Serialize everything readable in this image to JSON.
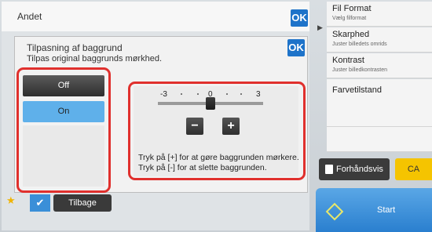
{
  "outer": {
    "title": "Andet",
    "ok_label": "OK"
  },
  "dialog": {
    "ok_label": "OK",
    "title": "Tilpasning af baggrund",
    "subtitle": "Tilpas original baggrunds mørkhed.",
    "off_label": "Off",
    "on_label": "On",
    "selected": "On",
    "scale": {
      "min_label": "-3",
      "mid_label": "0",
      "max_label": "3",
      "min": -3,
      "max": 3,
      "value": 0
    },
    "minus_label": "−",
    "plus_label": "+",
    "help_line1": "Tryk på [+] for at gøre baggrunden mørkere.",
    "help_line2": "Tryk på [-] for at slette baggrunden."
  },
  "side_menu": {
    "items": [
      {
        "title": "Fil Format",
        "desc": "Vælg filformat"
      },
      {
        "title": "Skarphed",
        "desc": "Juster billedets omrids"
      },
      {
        "title": "Kontrast",
        "desc": "Juster billedkontrasten"
      },
      {
        "title": "Farvetilstand",
        "desc": ""
      }
    ]
  },
  "preview_label": "Forhåndsvis",
  "ca_label": "CA",
  "start_label": "Start",
  "back_label": "Tilbage",
  "icons": {
    "star": "star-icon",
    "check": "check-icon",
    "play": "play-icon",
    "preview": "preview-icon",
    "start": "start-diamond-icon"
  },
  "colors": {
    "accent_blue": "#1e73c9",
    "highlight_red": "#e0302d",
    "ca_yellow": "#f5c400",
    "selected_blue": "#5fb0ea"
  }
}
